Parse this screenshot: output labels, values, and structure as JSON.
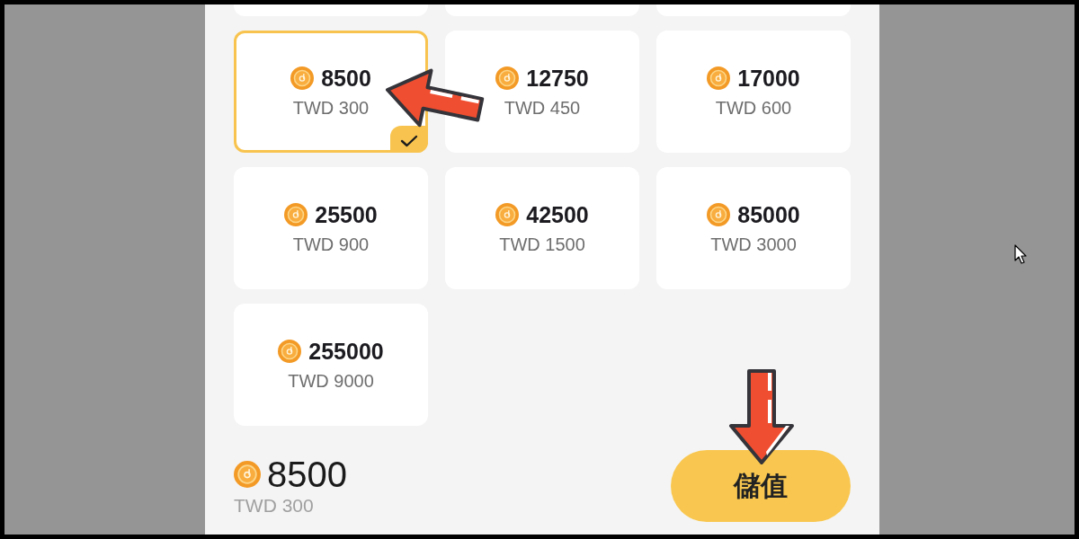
{
  "packages": [
    {
      "kind": "clipped",
      "selected": false
    },
    {
      "kind": "clipped",
      "selected": false
    },
    {
      "kind": "clipped",
      "selected": false
    },
    {
      "kind": "full",
      "coins": "8500",
      "price": "TWD 300",
      "selected": true
    },
    {
      "kind": "full",
      "coins": "12750",
      "price": "TWD 450",
      "selected": false
    },
    {
      "kind": "full",
      "coins": "17000",
      "price": "TWD 600",
      "selected": false
    },
    {
      "kind": "full",
      "coins": "25500",
      "price": "TWD 900",
      "selected": false
    },
    {
      "kind": "full",
      "coins": "42500",
      "price": "TWD 1500",
      "selected": false
    },
    {
      "kind": "full",
      "coins": "85000",
      "price": "TWD 3000",
      "selected": false
    },
    {
      "kind": "full",
      "coins": "255000",
      "price": "TWD 9000",
      "selected": false
    }
  ],
  "summary": {
    "coins": "8500",
    "price": "TWD 300"
  },
  "buy_button": {
    "label": "儲值"
  }
}
